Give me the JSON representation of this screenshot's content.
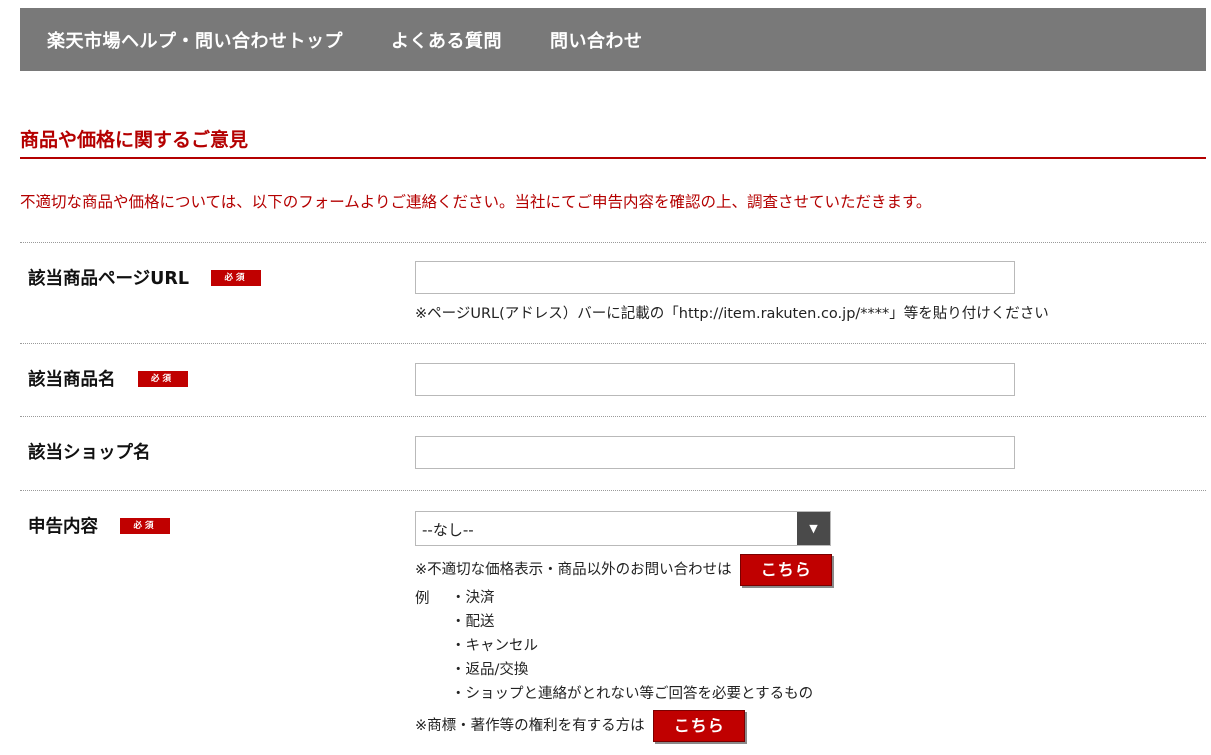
{
  "nav": {
    "items": [
      "楽天市場ヘルプ・問い合わせトップ",
      "よくある質問",
      "問い合わせ"
    ]
  },
  "section": {
    "title": "商品や価格に関するご意見",
    "intro": "不適切な商品や価格については、以下のフォームよりご連絡ください。当社にてご申告内容を確認の上、調査させていただきます。"
  },
  "required_badge": "必須",
  "form": {
    "url": {
      "label": "該当商品ページURL",
      "value": "",
      "hint": "※ページURL(アドレス）バーに記載の「http://item.rakuten.co.jp/****」等を貼り付けください"
    },
    "product_name": {
      "label": "該当商品名",
      "value": ""
    },
    "shop_name": {
      "label": "該当ショップ名",
      "value": ""
    },
    "report_type": {
      "label": "申告内容",
      "selected": "--なし--",
      "arrow": "▼",
      "other_inquiry_text": "※不適切な価格表示・商品以外のお問い合わせは",
      "button_label": "こちら",
      "example_head": "例",
      "examples": [
        "・決済",
        "・配送",
        "・キャンセル",
        "・返品/交換",
        "・ショップと連絡がとれない等ご回答を必要とするもの"
      ],
      "rights_text": "※商標・著作等の権利を有する方は",
      "rights_button_label": "こちら"
    }
  },
  "colors": {
    "nav_bg": "#797979",
    "accent": "#b40000",
    "button": "#c00000"
  }
}
